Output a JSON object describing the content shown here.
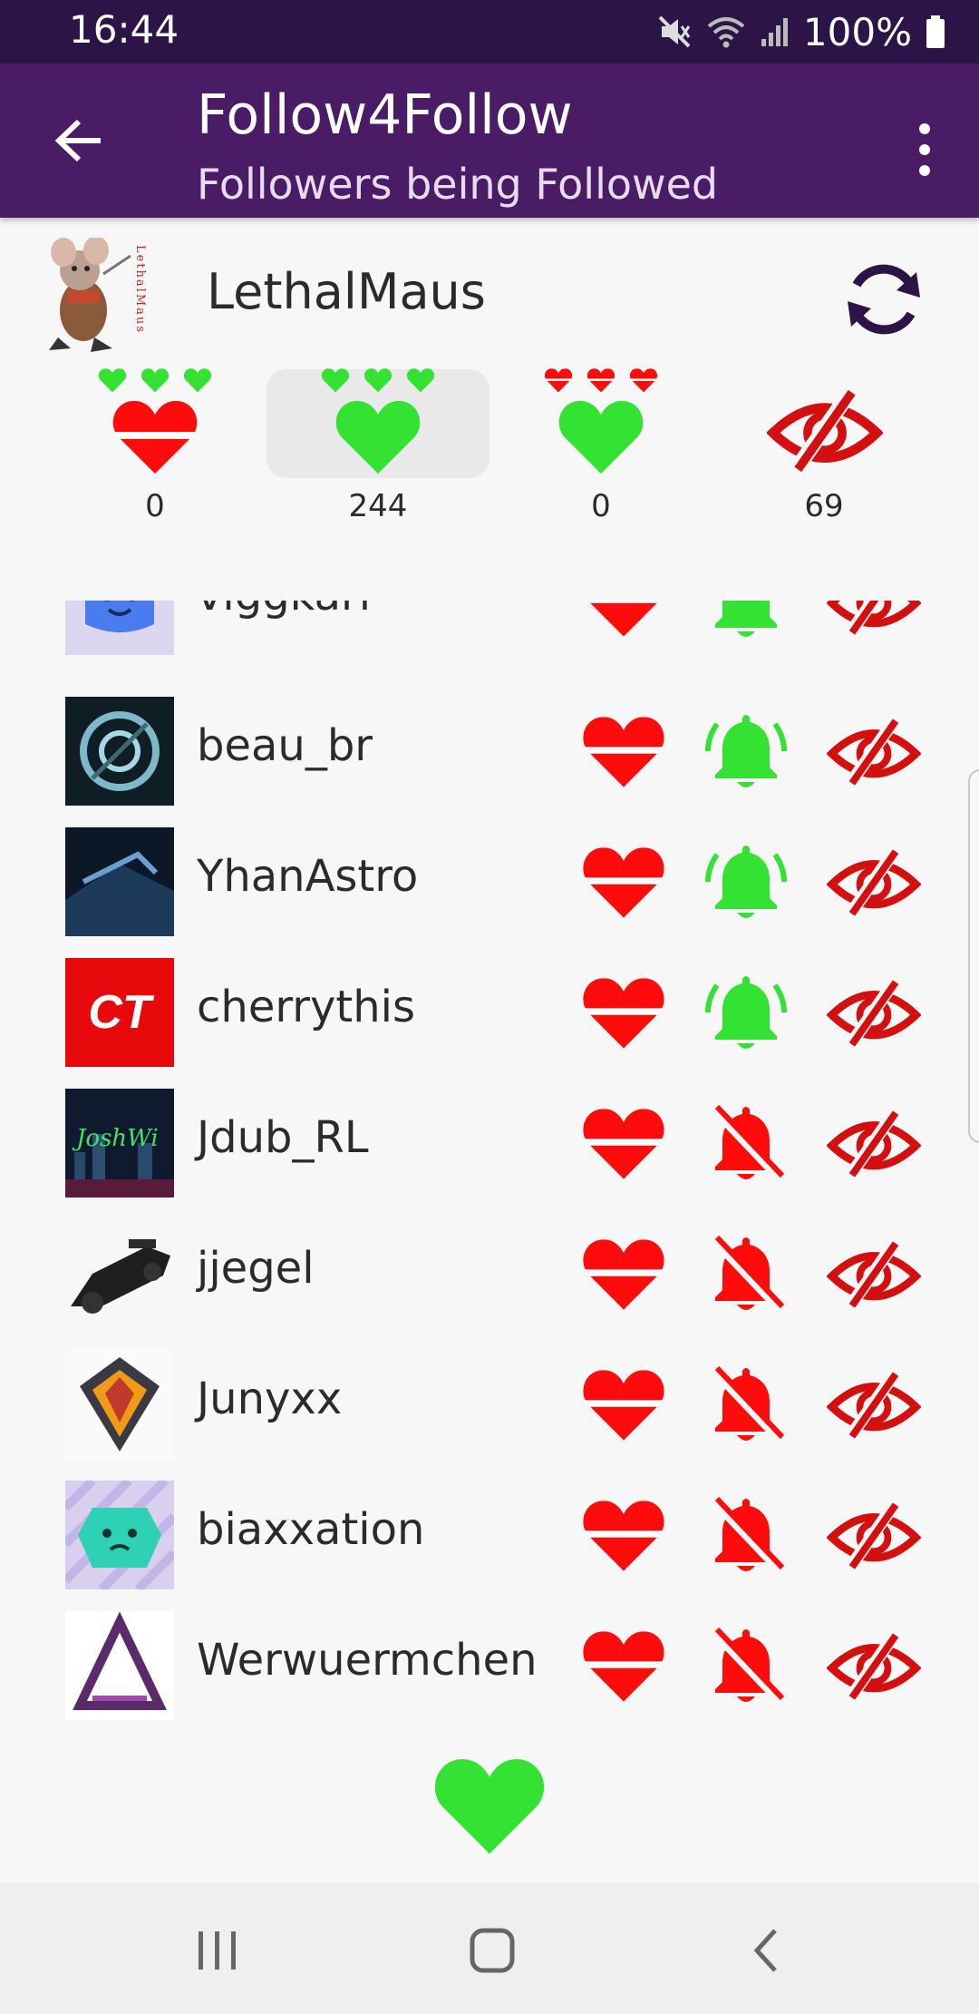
{
  "status_bar": {
    "time": "16:44",
    "battery": "100%"
  },
  "app_bar": {
    "title": "Follow4Follow",
    "subtitle": "Followers being Followed"
  },
  "profile": {
    "name": "LethalMaus",
    "avatar_text": "LethalMaus",
    "stats": [
      {
        "id": "not-following-back",
        "count": "0"
      },
      {
        "id": "mutual",
        "count": "244"
      },
      {
        "id": "following-only",
        "count": "0"
      },
      {
        "id": "excluded",
        "count": "69"
      }
    ]
  },
  "list": {
    "rows": [
      {
        "name": "viggkari",
        "notifications": "on"
      },
      {
        "name": "beau_br",
        "notifications": "on"
      },
      {
        "name": "YhanAstro",
        "notifications": "on"
      },
      {
        "name": "cherrythis",
        "notifications": "on",
        "avatar_text": "CT"
      },
      {
        "name": "Jdub_RL",
        "notifications": "off",
        "avatar_text": "JoshWi"
      },
      {
        "name": "jjegel",
        "notifications": "off"
      },
      {
        "name": "Junyxx",
        "notifications": "off"
      },
      {
        "name": "biaxxation",
        "notifications": "off"
      },
      {
        "name": "Werwuermchen",
        "notifications": "off"
      }
    ]
  },
  "colors": {
    "status_bar": "#2c1446",
    "app_bar": "#4a1c66",
    "green": "#33e233",
    "red": "#ff0b0b",
    "eye_red": "#d40f0f"
  }
}
